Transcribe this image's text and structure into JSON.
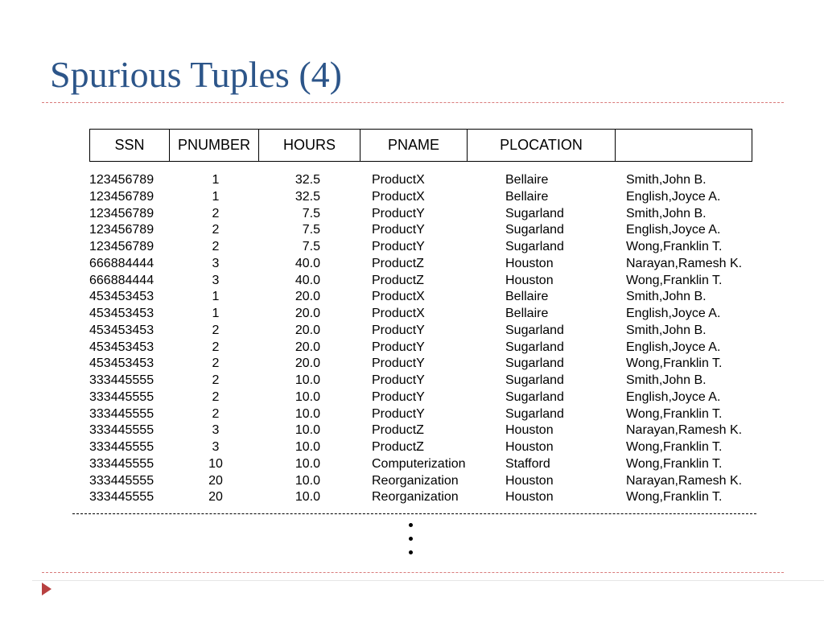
{
  "slide": {
    "title": "Spurious Tuples (4)"
  },
  "table": {
    "headers": [
      "SSN",
      "PNUMBER",
      "HOURS",
      "PNAME",
      "PLOCATION",
      ""
    ],
    "rows": [
      [
        "123456789",
        "1",
        "32.5",
        "ProductX",
        "Bellaire",
        "Smith,John B."
      ],
      [
        "123456789",
        "1",
        "32.5",
        "ProductX",
        "Bellaire",
        "English,Joyce A."
      ],
      [
        "123456789",
        "2",
        "7.5",
        "ProductY",
        "Sugarland",
        "Smith,John B."
      ],
      [
        "123456789",
        "2",
        "7.5",
        "ProductY",
        "Sugarland",
        "English,Joyce A."
      ],
      [
        "123456789",
        "2",
        "7.5",
        "ProductY",
        "Sugarland",
        "Wong,Franklin T."
      ],
      [
        "666884444",
        "3",
        "40.0",
        "ProductZ",
        "Houston",
        "Narayan,Ramesh K."
      ],
      [
        "666884444",
        "3",
        "40.0",
        "ProductZ",
        "Houston",
        "Wong,Franklin T."
      ],
      [
        "453453453",
        "1",
        "20.0",
        "ProductX",
        "Bellaire",
        "Smith,John B."
      ],
      [
        "453453453",
        "1",
        "20.0",
        "ProductX",
        "Bellaire",
        "English,Joyce A."
      ],
      [
        "453453453",
        "2",
        "20.0",
        "ProductY",
        "Sugarland",
        "Smith,John B."
      ],
      [
        "453453453",
        "2",
        "20.0",
        "ProductY",
        "Sugarland",
        "English,Joyce A."
      ],
      [
        "453453453",
        "2",
        "20.0",
        "ProductY",
        "Sugarland",
        "Wong,Franklin T."
      ],
      [
        "333445555",
        "2",
        "10.0",
        "ProductY",
        "Sugarland",
        "Smith,John B."
      ],
      [
        "333445555",
        "2",
        "10.0",
        "ProductY",
        "Sugarland",
        "English,Joyce A."
      ],
      [
        "333445555",
        "2",
        "10.0",
        "ProductY",
        "Sugarland",
        "Wong,Franklin T."
      ],
      [
        "333445555",
        "3",
        "10.0",
        "ProductZ",
        "Houston",
        "Narayan,Ramesh K."
      ],
      [
        "333445555",
        "3",
        "10.0",
        "ProductZ",
        "Houston",
        "Wong,Franklin T."
      ],
      [
        "333445555",
        "10",
        "10.0",
        "Computerization",
        "Stafford",
        "Wong,Franklin T."
      ],
      [
        "333445555",
        "20",
        "10.0",
        "Reorganization",
        "Houston",
        "Narayan,Ramesh K."
      ],
      [
        "333445555",
        "20",
        "10.0",
        "Reorganization",
        "Houston",
        "Wong,Franklin T."
      ]
    ]
  },
  "colors": {
    "title": "#2c5589",
    "rule": "#d97b7b",
    "bullet": "#b84040"
  }
}
